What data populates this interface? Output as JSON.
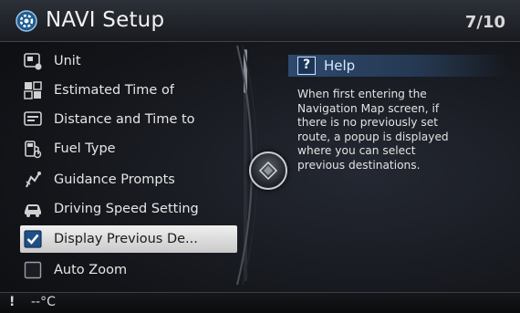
{
  "header": {
    "title": "NAVI Setup",
    "page_indicator": "7/10",
    "icon": "gear-icon"
  },
  "menu": {
    "items": [
      {
        "label": "Unit",
        "icon": "unit-icon",
        "selected": false
      },
      {
        "label": "Estimated Time of",
        "icon": "estimated-time-icon",
        "selected": false
      },
      {
        "label": "Distance and Time to",
        "icon": "distance-time-icon",
        "selected": false
      },
      {
        "label": "Fuel Type",
        "icon": "fuel-icon",
        "selected": false
      },
      {
        "label": "Guidance Prompts",
        "icon": "guidance-icon",
        "selected": false
      },
      {
        "label": "Driving Speed Setting",
        "icon": "car-icon",
        "selected": false
      },
      {
        "label": "Display Previous De...",
        "icon": "checkbox-checked-icon",
        "selected": true,
        "checked": true
      },
      {
        "label": "Auto Zoom",
        "icon": "checkbox-unchecked-icon",
        "selected": false,
        "checked": false
      }
    ]
  },
  "help": {
    "title": "Help",
    "icon_text": "?",
    "lines": [
      "When first entering the",
      "Navigation Map screen, if",
      "there is no previously set",
      "route, a popup is displayed",
      "where you can select",
      "previous destinations."
    ]
  },
  "footer": {
    "mark": "!",
    "temperature": "--°C"
  },
  "colors": {
    "accent": "#2d4a6e",
    "selection": "#e6e6e6",
    "background": "#14161b"
  }
}
